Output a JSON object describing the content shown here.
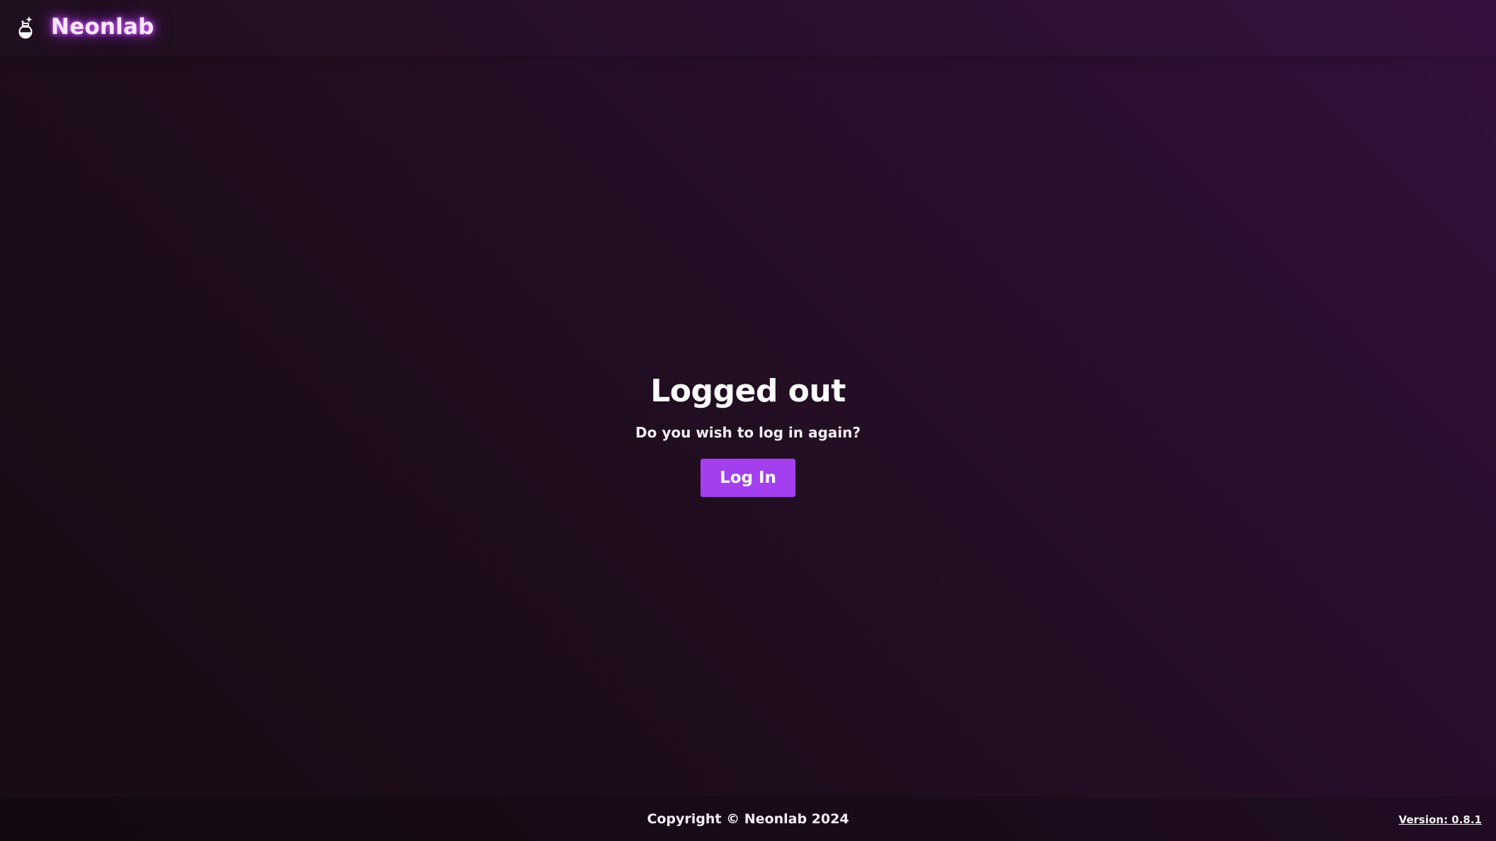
{
  "header": {
    "brand_name": "Neonlab",
    "brand_icon": "flask-sparkle-icon"
  },
  "main": {
    "title": "Logged out",
    "subtitle": "Do you wish to log in again?",
    "login_label": "Log In"
  },
  "footer": {
    "copyright": "Copyright © Neonlab 2024",
    "version": "Version: 0.8.1"
  },
  "colors": {
    "accent": "#a43ff0",
    "glow": "#d45cff",
    "background_dark": "#170b13",
    "background_light": "#33103c"
  }
}
